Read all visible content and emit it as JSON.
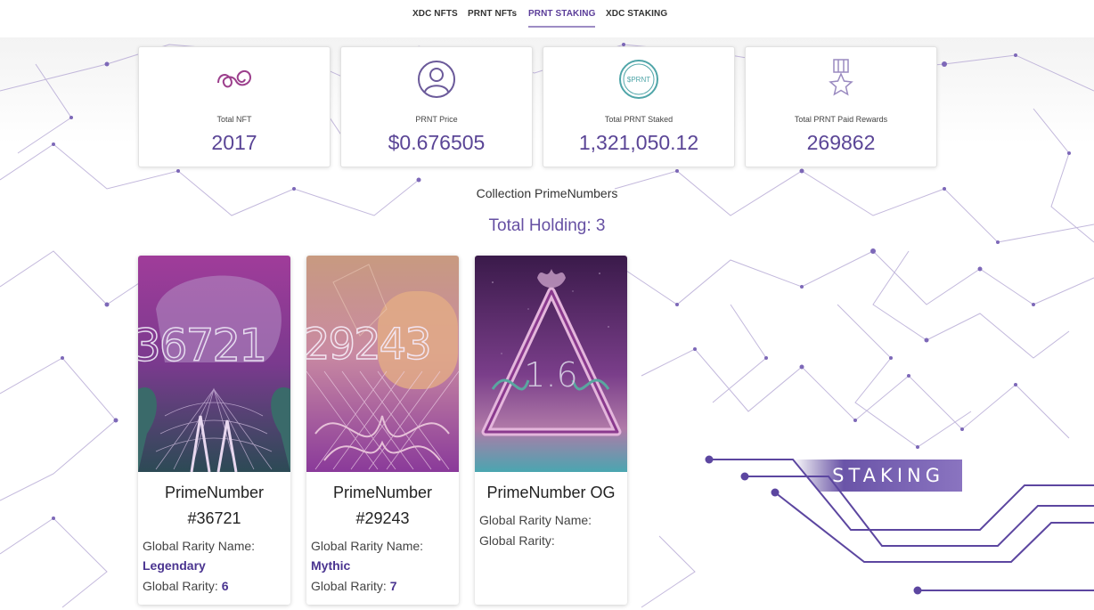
{
  "nav": {
    "items": [
      {
        "label": "XDC NFTS"
      },
      {
        "label": "PRNT NFTs"
      },
      {
        "label": "PRNT STAKING",
        "active": true
      },
      {
        "label": "XDC STAKING"
      }
    ]
  },
  "stats": [
    {
      "icon": "swirl-icon",
      "label": "Total NFT",
      "value": "2017"
    },
    {
      "icon": "user-circle-icon",
      "label": "PRNT Price",
      "value": "$0.676505"
    },
    {
      "icon": "prnt-coin-icon",
      "label": "Total PRNT Staked",
      "value": "1,321,050.12",
      "coin_text": "$PRNT"
    },
    {
      "icon": "medal-star-icon",
      "label": "Total PRNT Paid Rewards",
      "value": "269862"
    }
  ],
  "collection": {
    "title": "Collection PrimeNumbers",
    "total_holding": "Total Holding: 3"
  },
  "nfts": [
    {
      "title_line1": "PrimeNumber",
      "title_line2": "#36721",
      "art_number": "36721",
      "rarity_name_label": "Global Rarity Name:",
      "rarity_name": "Legendary",
      "rarity_label": "Global Rarity:",
      "rarity": "6"
    },
    {
      "title_line1": "PrimeNumber",
      "title_line2": "#29243",
      "art_number": "29243",
      "rarity_name_label": "Global Rarity Name:",
      "rarity_name": "Mythic",
      "rarity_label": "Global Rarity:",
      "rarity": "7"
    },
    {
      "title_line1": "PrimeNumber OG",
      "art_number": "1.6",
      "rarity_name_label": "Global Rarity Name:",
      "rarity_label": "Global Rarity:"
    }
  ],
  "banner": {
    "label": "STAKING"
  },
  "colors": {
    "accent": "#5a4596",
    "network": "#7d68b8",
    "banner": "#7a64b4"
  }
}
